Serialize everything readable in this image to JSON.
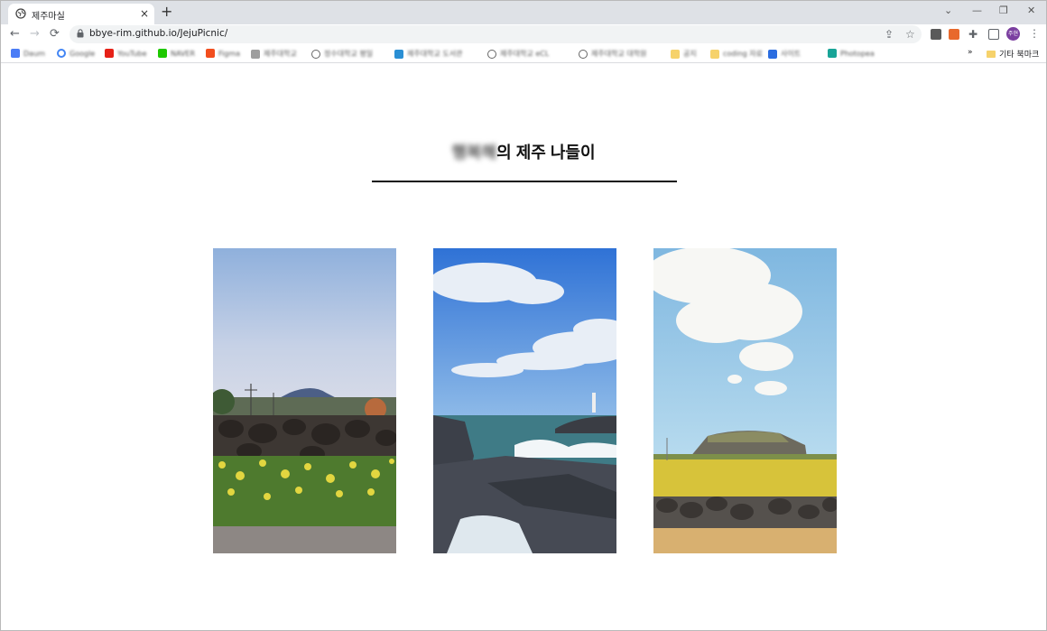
{
  "browser": {
    "tab_title": "제주마실",
    "new_tab_label": "+",
    "tab_close_label": "×",
    "window_buttons": [
      "⌄",
      "—",
      "❐",
      "✕"
    ],
    "url": "bbye-rim.github.io/JejuPicnic/",
    "profile_label": "주현",
    "bookmarks": [
      {
        "label": "Daum",
        "icon": "daum-icon",
        "color": "#4a7cf6"
      },
      {
        "label": "Google",
        "icon": "google-icon",
        "color": "#4285f4"
      },
      {
        "label": "YouTube",
        "icon": "youtube-icon",
        "color": "#e62117"
      },
      {
        "label": "NAVER",
        "icon": "naver-icon",
        "color": "#1ec800"
      },
      {
        "label": "Figma",
        "icon": "figma-icon",
        "color": "#f24e1e"
      },
      {
        "label": "제주대학교",
        "icon": "page-icon",
        "color": "#9e9e9e"
      },
      {
        "label": "정수대학교 평일",
        "icon": "globe-icon",
        "color": "#666666"
      },
      {
        "label": "제주대학교 도서관",
        "icon": "library-icon",
        "color": "#2a8fd4"
      },
      {
        "label": "제주대학교 eCL",
        "icon": "globe-icon",
        "color": "#666666"
      },
      {
        "label": "제주대학교 대학원",
        "icon": "globe-icon",
        "color": "#666666"
      },
      {
        "label": "공지",
        "icon": "folder-icon",
        "color": "#f6d26b"
      },
      {
        "label": "coding 자료",
        "icon": "folder-icon",
        "color": "#f6d26b"
      },
      {
        "label": "사이트",
        "icon": "k-icon",
        "color": "#2b6de0"
      },
      {
        "label": "Photopea",
        "icon": "photopea-icon",
        "color": "#18a497"
      }
    ],
    "more_bookmarks_label": "»",
    "other_bookmarks_label": "기타 북마크"
  },
  "page": {
    "heading_name": "행복해",
    "heading_rest": "의 제주 나들이",
    "photos": [
      {
        "subject": "rapeseed field with stone wall and distant oreum"
      },
      {
        "subject": "waves crashing on black volcanic rocks"
      },
      {
        "subject": "yellow field with Seongsan Ilchulbong and stone wall"
      }
    ]
  },
  "colors": {
    "accent_rule": "#111111",
    "tab_strip": "#dee1e6",
    "omnibox": "#f1f3f4"
  }
}
